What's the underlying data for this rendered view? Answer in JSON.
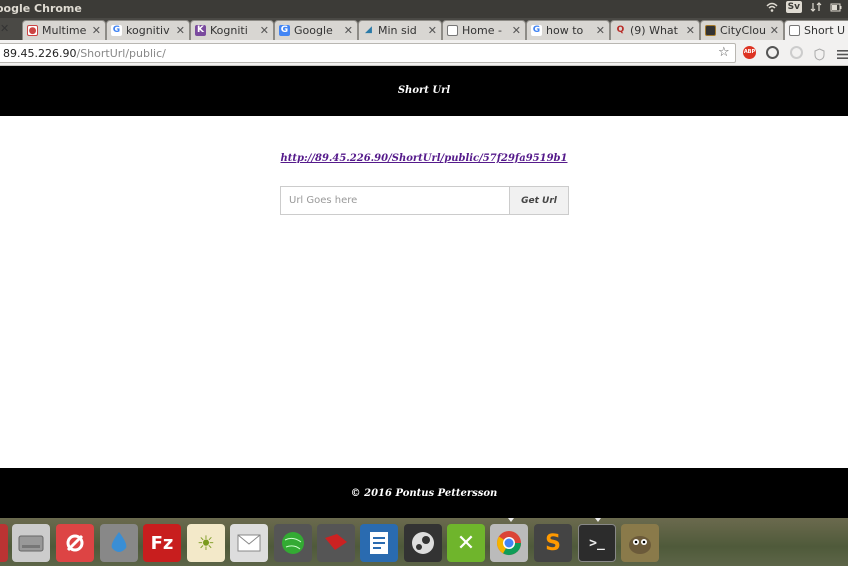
{
  "window": {
    "title": "oogle Chrome"
  },
  "top_panel": {
    "lang": "Sv"
  },
  "tabs": [
    {
      "label": "Multime",
      "favicon": "multimedia-icon"
    },
    {
      "label": "kognitiv",
      "favicon": "google-icon"
    },
    {
      "label": "Kogniti",
      "favicon": "kognitiv-icon"
    },
    {
      "label": "Google",
      "favicon": "google-translate-icon"
    },
    {
      "label": "Min sid",
      "favicon": "min-sida-icon"
    },
    {
      "label": "Home -",
      "favicon": "document-icon"
    },
    {
      "label": "how to",
      "favicon": "google-icon"
    },
    {
      "label": "(9) What",
      "favicon": "quora-icon"
    },
    {
      "label": "CityClou",
      "favicon": "citycloud-icon"
    },
    {
      "label": "Short U",
      "favicon": "document-icon",
      "active": true
    }
  ],
  "address_bar": {
    "host": "89.45.226.90",
    "path": "/ShortUrl/public/"
  },
  "site": {
    "header_title": "Short Url",
    "short_link": "http://89.45.226.90/ShortUrl/public/57f29fa9519b1",
    "input_placeholder": "Url Goes here",
    "button_label": "Get Url",
    "footer_text": "© 2016 Pontus Pettersson"
  },
  "dock_icons": [
    "files-icon",
    "system-settings-icon",
    "drop-icon",
    "filezilla-icon",
    "brightness-icon",
    "mail-icon",
    "network-icon",
    "book-icon",
    "writer-icon",
    "steam-icon",
    "xmind-icon",
    "chrome-icon",
    "sublime-icon",
    "terminal-icon",
    "gimp-icon"
  ]
}
